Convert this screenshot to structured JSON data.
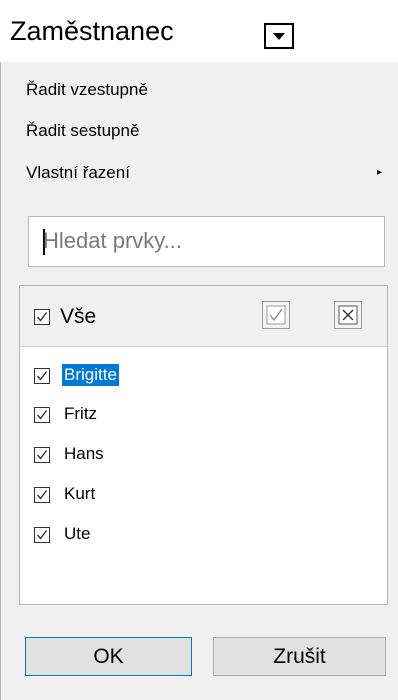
{
  "column": {
    "title": "Zaměstnanec"
  },
  "menu": {
    "sort_asc": "Řadit vzestupně",
    "sort_desc": "Řadit sestupně",
    "custom_sort": "Vlastní řazení"
  },
  "search": {
    "placeholder": "Hledat prvky..."
  },
  "filter": {
    "select_all_label": "Vše",
    "items": [
      {
        "label": "Brigitte",
        "checked": true,
        "selected": true
      },
      {
        "label": "Fritz",
        "checked": true,
        "selected": false
      },
      {
        "label": "Hans",
        "checked": true,
        "selected": false
      },
      {
        "label": "Kurt",
        "checked": true,
        "selected": false
      },
      {
        "label": "Ute",
        "checked": true,
        "selected": false
      }
    ]
  },
  "buttons": {
    "ok": "OK",
    "cancel": "Zrušit"
  },
  "colors": {
    "selection": "#0078d7",
    "panel": "#f0f0f0"
  },
  "icons": {
    "dropdown": "triangle-down-icon",
    "submenu": "triangle-right-icon",
    "check_all": "checkmark-icon",
    "uncheck_all": "x-icon"
  }
}
